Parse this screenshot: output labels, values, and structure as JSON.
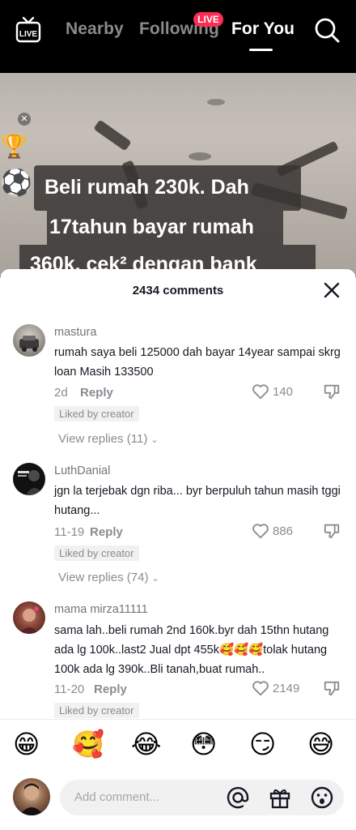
{
  "topbar": {
    "live_icon_label": "LIVE",
    "tabs": [
      {
        "label": "Nearby"
      },
      {
        "label": "Following"
      },
      {
        "label": "For You"
      }
    ],
    "live_badge": "LIVE",
    "active_tab": "For You",
    "search_icon": "search-icon"
  },
  "video": {
    "caption_lines": [
      "Beli rumah 230k. Dah",
      "17tahun bayar rumah",
      "360k, cek² dengan bank"
    ]
  },
  "sheet": {
    "count": "2434 comments"
  },
  "comments": [
    {
      "username": "mastura",
      "text": "rumah saya beli 125000 dah bayar 14year sampai skrg loan Masih 133500",
      "time": "2d",
      "reply": "Reply",
      "likes": "140",
      "badge": "Liked by creator",
      "view_replies": "View replies (11)"
    },
    {
      "username": "LuthDanial",
      "text": "jgn la terjebak dgn riba... byr berpuluh tahun masih tggi hutang...",
      "time": "11-19",
      "reply": "Reply",
      "likes": "886",
      "badge": "Liked by creator",
      "view_replies": "View replies (74)"
    },
    {
      "username": "mama mirza11111",
      "text": "sama lah..beli rumah 2nd 160k.byr dah 15thn hutang ada lg 100k..last2 Jual dpt 455k🥰🥰🥰tolak hutang 100k ada lg 390k..Bli tanah,buat rumah..",
      "time": "11-20",
      "reply": "Reply",
      "likes": "2149",
      "badge": "Liked by creator"
    }
  ],
  "emoji_bar": [
    "😁",
    "🥰",
    "😂",
    "😳",
    "😏",
    "😅"
  ],
  "input": {
    "placeholder": "Add comment..."
  },
  "icons": [
    "at-icon",
    "gift-icon",
    "emoji-icon",
    "heart-icon",
    "dislike-icon",
    "close-icon"
  ],
  "colors": {
    "accent": "#fe2c55",
    "text_primary": "#161823",
    "text_secondary": "#8a8b91"
  }
}
